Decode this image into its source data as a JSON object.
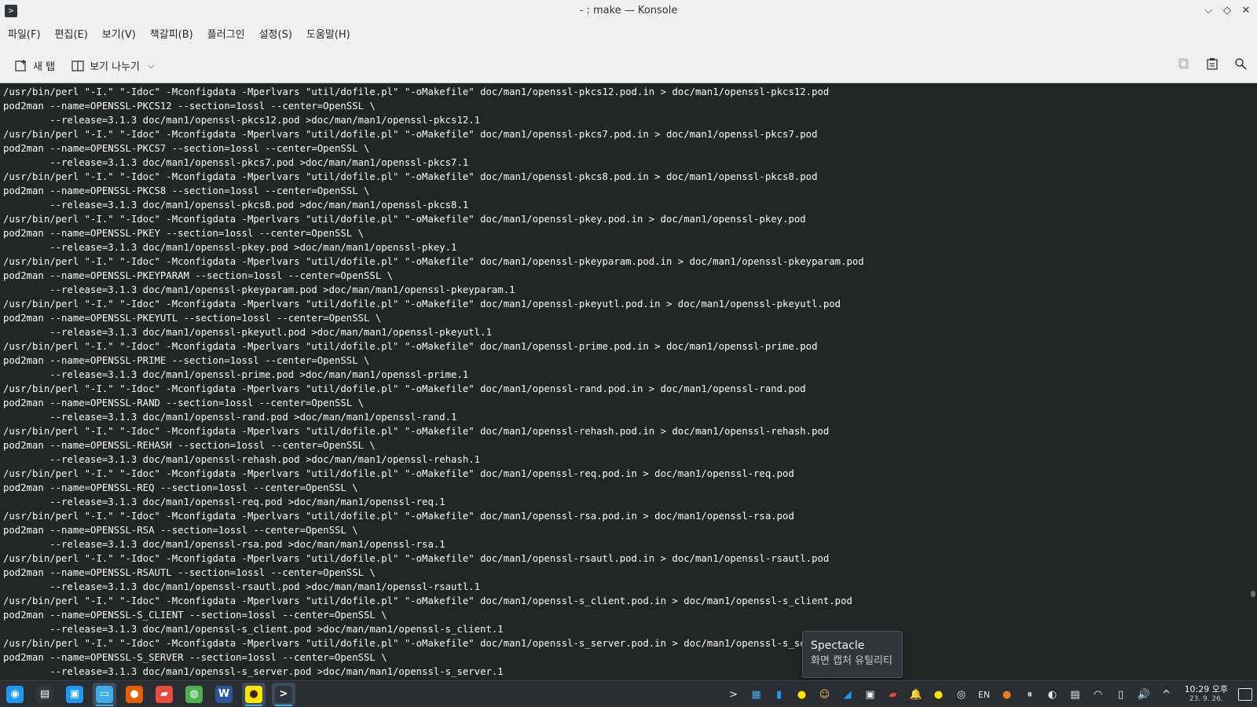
{
  "window": {
    "title": "- : make — Konsole",
    "app_icon_glyph": ">",
    "controls": {
      "minimize": "⌵",
      "maximize": "◇",
      "close": "✕"
    }
  },
  "menu": [
    "파일(F)",
    "편집(E)",
    "보기(V)",
    "책갈피(B)",
    "플러그인",
    "설정(S)",
    "도움말(H)"
  ],
  "toolbar": {
    "new_tab_label": "새 탭",
    "split_view_label": "보기 나누기",
    "split_view_chevron": "⌵",
    "right_icons": [
      "copy-icon",
      "paste-icon",
      "search-icon"
    ]
  },
  "terminal": {
    "lines": [
      "/usr/bin/perl \"-I.\" \"-Idoc\" -Mconfigdata -Mperlvars \"util/dofile.pl\" \"-oMakefile\" doc/man1/openssl-pkcs12.pod.in > doc/man1/openssl-pkcs12.pod",
      "pod2man --name=OPENSSL-PKCS12 --section=1ossl --center=OpenSSL \\",
      "        --release=3.1.3 doc/man1/openssl-pkcs12.pod >doc/man/man1/openssl-pkcs12.1",
      "/usr/bin/perl \"-I.\" \"-Idoc\" -Mconfigdata -Mperlvars \"util/dofile.pl\" \"-oMakefile\" doc/man1/openssl-pkcs7.pod.in > doc/man1/openssl-pkcs7.pod",
      "pod2man --name=OPENSSL-PKCS7 --section=1ossl --center=OpenSSL \\",
      "        --release=3.1.3 doc/man1/openssl-pkcs7.pod >doc/man/man1/openssl-pkcs7.1",
      "/usr/bin/perl \"-I.\" \"-Idoc\" -Mconfigdata -Mperlvars \"util/dofile.pl\" \"-oMakefile\" doc/man1/openssl-pkcs8.pod.in > doc/man1/openssl-pkcs8.pod",
      "pod2man --name=OPENSSL-PKCS8 --section=1ossl --center=OpenSSL \\",
      "        --release=3.1.3 doc/man1/openssl-pkcs8.pod >doc/man/man1/openssl-pkcs8.1",
      "/usr/bin/perl \"-I.\" \"-Idoc\" -Mconfigdata -Mperlvars \"util/dofile.pl\" \"-oMakefile\" doc/man1/openssl-pkey.pod.in > doc/man1/openssl-pkey.pod",
      "pod2man --name=OPENSSL-PKEY --section=1ossl --center=OpenSSL \\",
      "        --release=3.1.3 doc/man1/openssl-pkey.pod >doc/man/man1/openssl-pkey.1",
      "/usr/bin/perl \"-I.\" \"-Idoc\" -Mconfigdata -Mperlvars \"util/dofile.pl\" \"-oMakefile\" doc/man1/openssl-pkeyparam.pod.in > doc/man1/openssl-pkeyparam.pod",
      "pod2man --name=OPENSSL-PKEYPARAM --section=1ossl --center=OpenSSL \\",
      "        --release=3.1.3 doc/man1/openssl-pkeyparam.pod >doc/man/man1/openssl-pkeyparam.1",
      "/usr/bin/perl \"-I.\" \"-Idoc\" -Mconfigdata -Mperlvars \"util/dofile.pl\" \"-oMakefile\" doc/man1/openssl-pkeyutl.pod.in > doc/man1/openssl-pkeyutl.pod",
      "pod2man --name=OPENSSL-PKEYUTL --section=1ossl --center=OpenSSL \\",
      "        --release=3.1.3 doc/man1/openssl-pkeyutl.pod >doc/man/man1/openssl-pkeyutl.1",
      "/usr/bin/perl \"-I.\" \"-Idoc\" -Mconfigdata -Mperlvars \"util/dofile.pl\" \"-oMakefile\" doc/man1/openssl-prime.pod.in > doc/man1/openssl-prime.pod",
      "pod2man --name=OPENSSL-PRIME --section=1ossl --center=OpenSSL \\",
      "        --release=3.1.3 doc/man1/openssl-prime.pod >doc/man/man1/openssl-prime.1",
      "/usr/bin/perl \"-I.\" \"-Idoc\" -Mconfigdata -Mperlvars \"util/dofile.pl\" \"-oMakefile\" doc/man1/openssl-rand.pod.in > doc/man1/openssl-rand.pod",
      "pod2man --name=OPENSSL-RAND --section=1ossl --center=OpenSSL \\",
      "        --release=3.1.3 doc/man1/openssl-rand.pod >doc/man/man1/openssl-rand.1",
      "/usr/bin/perl \"-I.\" \"-Idoc\" -Mconfigdata -Mperlvars \"util/dofile.pl\" \"-oMakefile\" doc/man1/openssl-rehash.pod.in > doc/man1/openssl-rehash.pod",
      "pod2man --name=OPENSSL-REHASH --section=1ossl --center=OpenSSL \\",
      "        --release=3.1.3 doc/man1/openssl-rehash.pod >doc/man/man1/openssl-rehash.1",
      "/usr/bin/perl \"-I.\" \"-Idoc\" -Mconfigdata -Mperlvars \"util/dofile.pl\" \"-oMakefile\" doc/man1/openssl-req.pod.in > doc/man1/openssl-req.pod",
      "pod2man --name=OPENSSL-REQ --section=1ossl --center=OpenSSL \\",
      "        --release=3.1.3 doc/man1/openssl-req.pod >doc/man/man1/openssl-req.1",
      "/usr/bin/perl \"-I.\" \"-Idoc\" -Mconfigdata -Mperlvars \"util/dofile.pl\" \"-oMakefile\" doc/man1/openssl-rsa.pod.in > doc/man1/openssl-rsa.pod",
      "pod2man --name=OPENSSL-RSA --section=1ossl --center=OpenSSL \\",
      "        --release=3.1.3 doc/man1/openssl-rsa.pod >doc/man/man1/openssl-rsa.1",
      "/usr/bin/perl \"-I.\" \"-Idoc\" -Mconfigdata -Mperlvars \"util/dofile.pl\" \"-oMakefile\" doc/man1/openssl-rsautl.pod.in > doc/man1/openssl-rsautl.pod",
      "pod2man --name=OPENSSL-RSAUTL --section=1ossl --center=OpenSSL \\",
      "        --release=3.1.3 doc/man1/openssl-rsautl.pod >doc/man/man1/openssl-rsautl.1",
      "/usr/bin/perl \"-I.\" \"-Idoc\" -Mconfigdata -Mperlvars \"util/dofile.pl\" \"-oMakefile\" doc/man1/openssl-s_client.pod.in > doc/man1/openssl-s_client.pod",
      "pod2man --name=OPENSSL-S_CLIENT --section=1ossl --center=OpenSSL \\",
      "        --release=3.1.3 doc/man1/openssl-s_client.pod >doc/man/man1/openssl-s_client.1",
      "/usr/bin/perl \"-I.\" \"-Idoc\" -Mconfigdata -Mperlvars \"util/dofile.pl\" \"-oMakefile\" doc/man1/openssl-s_server.pod.in > doc/man1/openssl-s_server.pod",
      "pod2man --name=OPENSSL-S_SERVER --section=1ossl --center=OpenSSL \\",
      "        --release=3.1.3 doc/man1/openssl-s_server.pod >doc/man/man1/openssl-s_server.1"
    ]
  },
  "tooltip": {
    "title": "Spectacle",
    "subtitle": "화면 캡처 유틸리티"
  },
  "taskbar": {
    "launchers": [
      {
        "name": "app-launcher-icon",
        "glyph": "◉",
        "bg": "#1d99f3",
        "active": false
      },
      {
        "name": "system-monitor-icon",
        "glyph": "▤",
        "bg": "#31363b",
        "active": false
      },
      {
        "name": "discover-store-icon",
        "glyph": "▣",
        "bg": "#1d99f3",
        "active": false
      },
      {
        "name": "dolphin-file-manager-icon",
        "glyph": "▭",
        "bg": "#3daee9",
        "active": true
      },
      {
        "name": "firefox-icon",
        "glyph": "●",
        "bg": "#e66000",
        "active": false
      },
      {
        "name": "gitkraken-icon",
        "glyph": "▰",
        "bg": "#e74c3c",
        "active": false
      },
      {
        "name": "chrome-icon",
        "glyph": "◍",
        "bg": "#4caf50",
        "active": false
      },
      {
        "name": "word-icon",
        "glyph": "W",
        "bg": "#2b579a",
        "active": false
      },
      {
        "name": "kakaotalk-icon",
        "glyph": "●",
        "bg": "#fee500",
        "active": true
      },
      {
        "name": "konsole-icon",
        "glyph": ">",
        "bg": "#31363b",
        "active": true
      }
    ],
    "tray": [
      {
        "name": "konsole-tray-icon",
        "glyph": ">"
      },
      {
        "name": "screen-tray-icon",
        "glyph": "▦"
      },
      {
        "name": "notes-tray-icon",
        "glyph": "▮"
      },
      {
        "name": "chat-tray-icon",
        "glyph": "●"
      },
      {
        "name": "emoji-tray-icon",
        "glyph": "☺"
      },
      {
        "name": "krita-tray-icon",
        "glyph": "◢"
      },
      {
        "name": "display-tray-icon",
        "glyph": "▣"
      },
      {
        "name": "game-tray-icon",
        "glyph": "▰"
      },
      {
        "name": "notifications-tray-icon",
        "glyph": "🔔"
      },
      {
        "name": "kakaotalk-tray-icon",
        "glyph": "●"
      },
      {
        "name": "accessibility-tray-icon",
        "glyph": "◎"
      },
      {
        "name": "keyboard-layout-label",
        "glyph": "EN"
      },
      {
        "name": "cookie-tray-icon",
        "glyph": "●"
      },
      {
        "name": "pause-tray-icon",
        "glyph": "⏸"
      },
      {
        "name": "night-light-tray-icon",
        "glyph": "◐"
      },
      {
        "name": "clipboard-tray-icon",
        "glyph": "▤"
      },
      {
        "name": "wifi-icon",
        "glyph": "◠"
      },
      {
        "name": "battery-icon",
        "glyph": "▯"
      },
      {
        "name": "volume-icon",
        "glyph": "🔊"
      },
      {
        "name": "expand-tray-icon",
        "glyph": "^"
      }
    ],
    "clock_time": "10:29 오후",
    "clock_date": "23. 9. 26."
  }
}
